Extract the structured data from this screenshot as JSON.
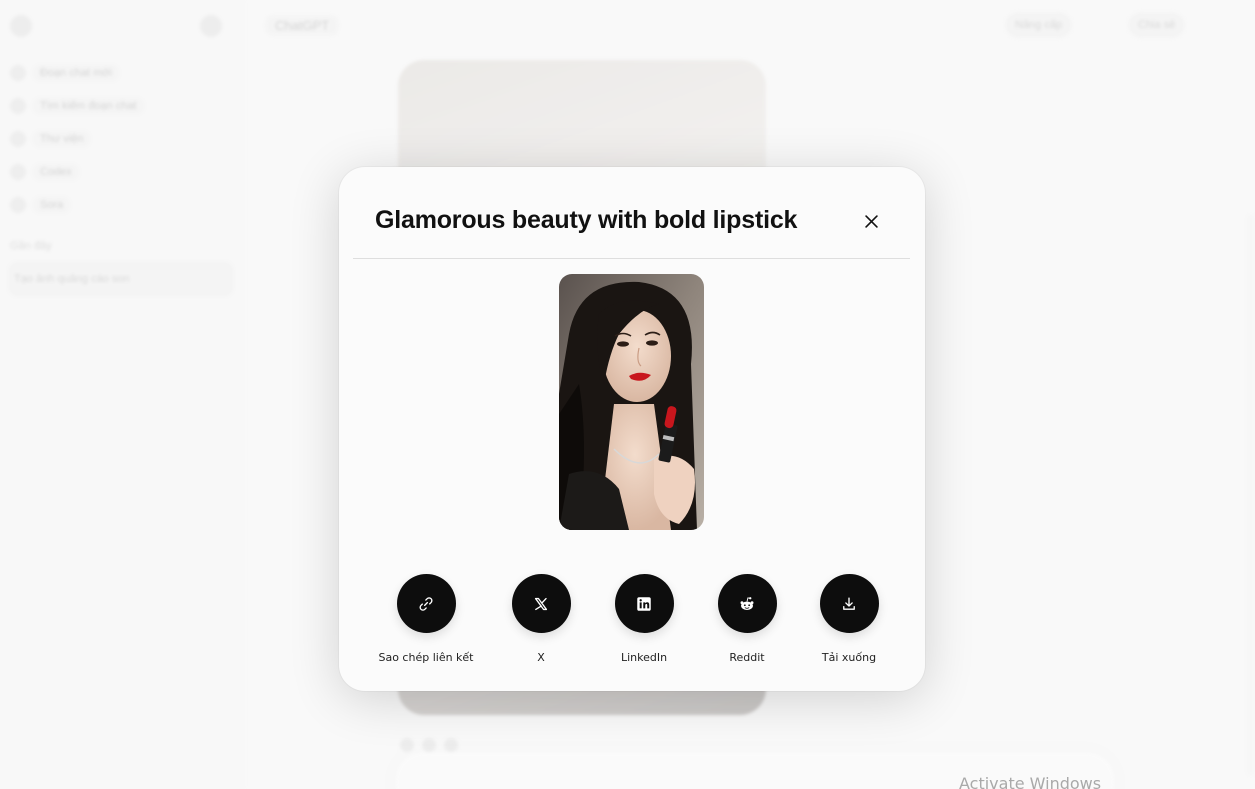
{
  "background": {
    "sidebar_items": [
      "Đoạn chat mới",
      "Tìm kiếm đoạn chat",
      "Thư viện",
      "Codex",
      "Sora"
    ],
    "sidebar_section_label": "Gần đây",
    "recent_chat": "Tạo ảnh quảng cáo son",
    "app_title": "ChatGPT",
    "share_label": "Chia sẻ",
    "upgrade_label": "Nâng cấp"
  },
  "modal": {
    "title": "Glamorous beauty with bold lipstick",
    "close_icon": "close-icon",
    "image_alt": "woman-with-red-lipstick-photo",
    "share_options": [
      {
        "label": "Sao chép liên kết",
        "icon": "link-icon"
      },
      {
        "label": "X",
        "icon": "x-logo-icon"
      },
      {
        "label": "LinkedIn",
        "icon": "linkedin-icon"
      },
      {
        "label": "Reddit",
        "icon": "reddit-icon"
      },
      {
        "label": "Tải xuống",
        "icon": "download-icon"
      }
    ]
  },
  "system": {
    "watermark": "Activate Windows"
  },
  "colors": {
    "button_bg": "#0d0d0d",
    "modal_bg": "#fbfbfb",
    "lipstick_red": "#c8161d"
  }
}
